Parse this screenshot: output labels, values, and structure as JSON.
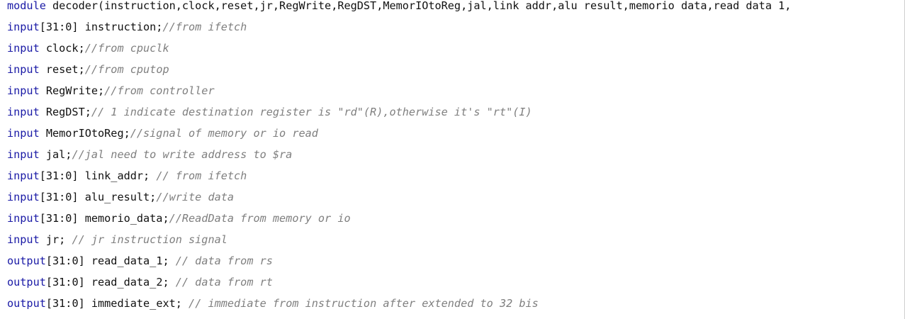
{
  "editor": {
    "lines": [
      {
        "keyword": "module",
        "code": " decoder(instruction,clock,reset,jr,RegWrite,RegDST,MemorIOtoReg,jal,link_addr,alu_result,memorio_data,read_data_1,",
        "comment": ""
      },
      {
        "keyword": "input",
        "code": "[31:0] instruction;",
        "comment": "//from ifetch"
      },
      {
        "keyword": "input",
        "code": " clock;",
        "comment": "//from cpuclk"
      },
      {
        "keyword": "input",
        "code": " reset;",
        "comment": "//from cputop"
      },
      {
        "keyword": "input",
        "code": " RegWrite;",
        "comment": "//from controller"
      },
      {
        "keyword": "input",
        "code": " RegDST;",
        "comment": "// 1 indicate destination register is \"rd\"(R),otherwise it's \"rt\"(I)"
      },
      {
        "keyword": "input",
        "code": " MemorIOtoReg;",
        "comment": "//signal of memory or io read"
      },
      {
        "keyword": "input",
        "code": " jal;",
        "comment": "//jal need to write address to $ra"
      },
      {
        "keyword": "input",
        "code": "[31:0] link_addr; ",
        "comment": "// from ifetch"
      },
      {
        "keyword": "input",
        "code": "[31:0] alu_result;",
        "comment": "//write data"
      },
      {
        "keyword": "input",
        "code": "[31:0] memorio_data;",
        "comment": "//ReadData from memory or io"
      },
      {
        "keyword": "input",
        "code": " jr; ",
        "comment": "// jr instruction signal"
      },
      {
        "keyword": "output",
        "code": "[31:0] read_data_1; ",
        "comment": "// data from rs"
      },
      {
        "keyword": "output",
        "code": "[31:0] read_data_2; ",
        "comment": "// data from rt"
      },
      {
        "keyword": "output",
        "code": "[31:0] immediate_ext; ",
        "comment": "// immediate from instruction after extended to 32 bis"
      }
    ]
  },
  "colors": {
    "keyword": "#1a1aa6",
    "identifier": "#111111",
    "comment": "#7f7f7f",
    "background": "#ffffff"
  }
}
